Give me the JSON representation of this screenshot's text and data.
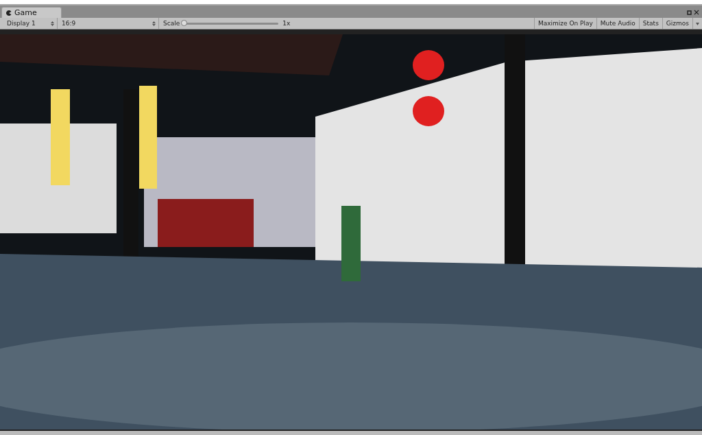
{
  "tab": {
    "title": "Game",
    "selected": true
  },
  "toolbar": {
    "display": "Display 1",
    "aspect": "16:9",
    "scale": {
      "label": "Scale",
      "level": 0,
      "reading": "1x"
    },
    "toggles": [
      {
        "label": "Maximize On Play",
        "on": false
      },
      {
        "label": "Mute Audio",
        "on": false
      },
      {
        "label": "Stats",
        "on": false
      }
    ],
    "gizmos": "Gizmos"
  }
}
